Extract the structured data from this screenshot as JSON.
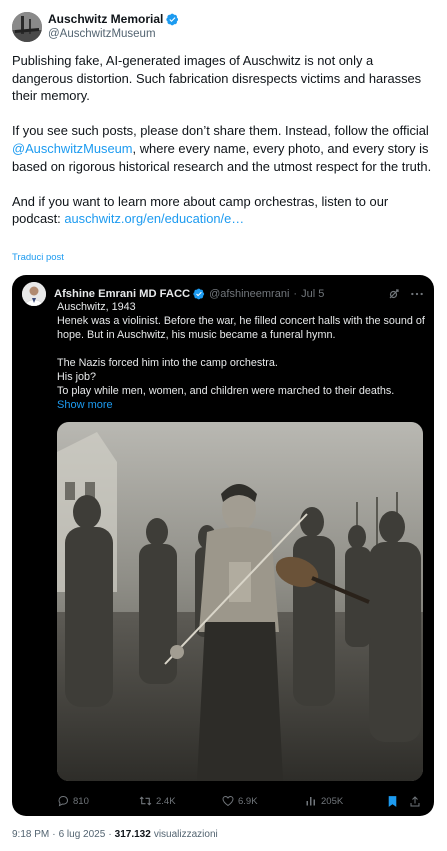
{
  "account": {
    "display_name": "Auschwitz Memorial",
    "handle": "@AuschwitzMuseum",
    "verified_color": "#1d9bf0"
  },
  "tweet": {
    "p1": "Publishing fake, AI-generated images of Auschwitz is not only a dangerous distortion. Such fabrication disrespects victims and harasses their memory.",
    "p2_a": "If you see such posts, please don’t share them. Instead, follow the official ",
    "p2_link": "@AuschwitzMuseum",
    "p2_b": ", where every name, every photo, and every story is based on rigorous historical research and the utmost respect for the truth.",
    "p3_a": "And if you want to learn more about camp orchestras, listen to our podcast: ",
    "p3_link": "auschwitz.org/en/education/e…",
    "translate": "Traduci post"
  },
  "quote": {
    "display_name": "Afshine Emrani MD FACC",
    "handle": "@afshineemrani",
    "separator": "·",
    "date": "Jul 5",
    "lines_1": [
      "Auschwitz, 1943",
      "Henek was a violinist. Before the war, he filled concert halls with the sound of hope.  But in Auschwitz, his music became a funeral hymn."
    ],
    "line_a": "Auschwitz, 1943",
    "line_b": "Henek was a violinist. Before the war, he filled concert halls with the sound of hope.  But in Auschwitz, his music became a funeral hymn.",
    "line_c": "The Nazis forced him into the camp orchestra.",
    "line_d": "His job?",
    "line_e": "To play while men, women, and children were marched to their deaths.",
    "show_more": "Show more",
    "replies": "810",
    "reposts": "2.4K",
    "likes": "6.9K",
    "views": "205K"
  },
  "footer": {
    "time": "9:18 PM",
    "sep1": "·",
    "date": "6 lug 2025",
    "sep2": "·",
    "views": "317.132",
    "views_label": "visualizzazioni"
  },
  "colors": {
    "link": "#1d9bf0",
    "muted": "#536471",
    "quote_bg": "#000000"
  }
}
